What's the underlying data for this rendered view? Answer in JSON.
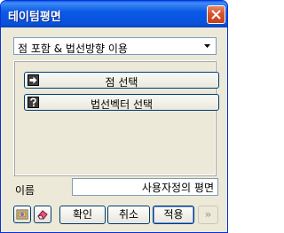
{
  "window": {
    "title": "테이텀평면"
  },
  "mode_select": {
    "selected": "점 포함 & 법선방향 이용"
  },
  "actions": {
    "point_select": "점 선택",
    "normal_vector_select": "법선벡터 선택"
  },
  "name_field": {
    "label": "이름",
    "value": "사용자정의 평면"
  },
  "buttons": {
    "confirm": "확인",
    "cancel": "취소",
    "apply": "적용",
    "more": "»"
  },
  "colors": {
    "titlebar": "#0a51d9",
    "dialog_bg": "#ece9d8",
    "close_button": "#d8542c",
    "button_border": "#003c74"
  },
  "icons": {
    "point": "arrow-right-icon",
    "normal": "question-icon",
    "tool1": "image-select-icon",
    "tool2": "eraser-icon"
  }
}
